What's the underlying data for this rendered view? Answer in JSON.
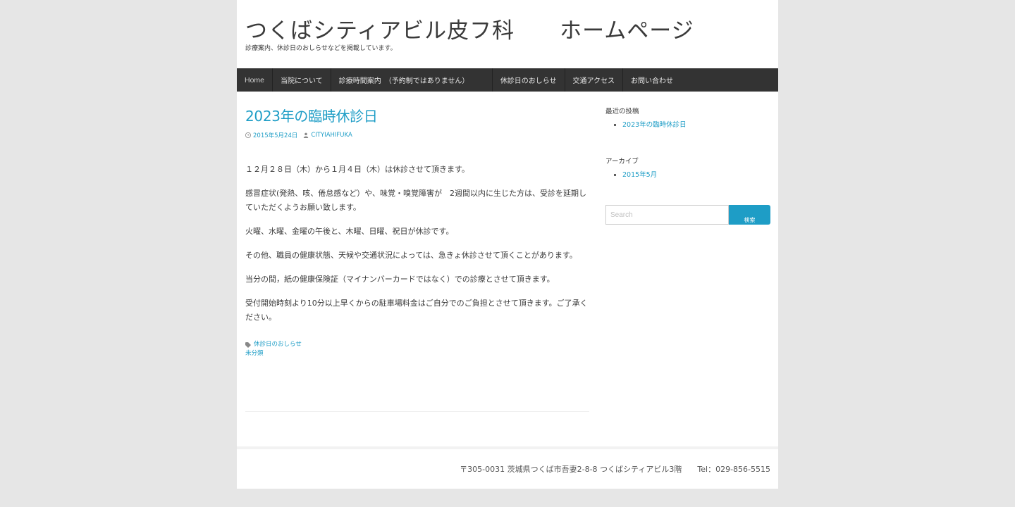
{
  "site": {
    "title": "つくばシティアビル皮フ科　　ホームページ",
    "description": "診療案内、休診日のおしらせなどを掲載しています。"
  },
  "nav": {
    "items": [
      "Home",
      "当院について",
      "診療時間案内　（予約制ではありません）",
      "休診日のおしらせ",
      "交通アクセス",
      "お問い合わせ"
    ]
  },
  "post": {
    "title": "2023年の臨時休診日",
    "date": "2015年5月24日",
    "author": "CITYIAHIFUKA",
    "paragraphs": [
      "１２月２８日（木）から１月４日（木）は休診させて頂きます。",
      "感冒症状(発熱、咳、倦怠感など）や、味覚・嗅覚障害が　2週間以内に生じた方は、受診を延期していただくようお願い致します。",
      "火曜、水曜、金曜の午後と、木曜、日曜、祝日が休診です。",
      "その他、職員の健康状態、天候や交通状況によっては、急きょ休診させて頂くことがあります。",
      "当分の間，紙の健康保険証（マイナンバーカードではなく）での診療とさせて頂きます。",
      "受付開始時刻より10分以上早くからの駐車場料金はご自分でのご負担とさせて頂きます。ご了承ください。"
    ],
    "categories": [
      "休診日のおしらせ",
      "未分類"
    ]
  },
  "sidebar": {
    "recent_title": "最近の投稿",
    "recent_posts": [
      "2023年の臨時休診日"
    ],
    "archive_title": "アーカイブ",
    "archives": [
      "2015年5月"
    ],
    "search_placeholder": "Search",
    "search_button": "検索"
  },
  "footer": {
    "address": "〒305-0031 茨城県つくば市吾妻2-8-8 つくばシティアビル3階　　Tel：029-856-5515"
  },
  "colors": {
    "accent": "#1e9dc6",
    "nav_bg": "#333333",
    "page_bg": "#e6e6e6"
  }
}
